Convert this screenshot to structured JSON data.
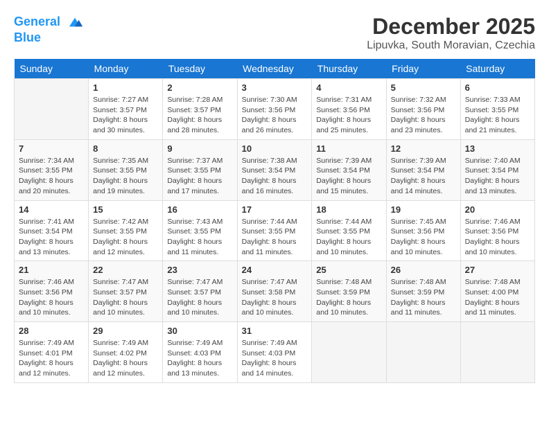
{
  "header": {
    "logo_line1": "General",
    "logo_line2": "Blue",
    "month_title": "December 2025",
    "location": "Lipuvka, South Moravian, Czechia"
  },
  "days_of_week": [
    "Sunday",
    "Monday",
    "Tuesday",
    "Wednesday",
    "Thursday",
    "Friday",
    "Saturday"
  ],
  "weeks": [
    [
      {
        "day": "",
        "sunrise": "",
        "sunset": "",
        "daylight": ""
      },
      {
        "day": "1",
        "sunrise": "Sunrise: 7:27 AM",
        "sunset": "Sunset: 3:57 PM",
        "daylight": "Daylight: 8 hours and 30 minutes."
      },
      {
        "day": "2",
        "sunrise": "Sunrise: 7:28 AM",
        "sunset": "Sunset: 3:57 PM",
        "daylight": "Daylight: 8 hours and 28 minutes."
      },
      {
        "day": "3",
        "sunrise": "Sunrise: 7:30 AM",
        "sunset": "Sunset: 3:56 PM",
        "daylight": "Daylight: 8 hours and 26 minutes."
      },
      {
        "day": "4",
        "sunrise": "Sunrise: 7:31 AM",
        "sunset": "Sunset: 3:56 PM",
        "daylight": "Daylight: 8 hours and 25 minutes."
      },
      {
        "day": "5",
        "sunrise": "Sunrise: 7:32 AM",
        "sunset": "Sunset: 3:56 PM",
        "daylight": "Daylight: 8 hours and 23 minutes."
      },
      {
        "day": "6",
        "sunrise": "Sunrise: 7:33 AM",
        "sunset": "Sunset: 3:55 PM",
        "daylight": "Daylight: 8 hours and 21 minutes."
      }
    ],
    [
      {
        "day": "7",
        "sunrise": "Sunrise: 7:34 AM",
        "sunset": "Sunset: 3:55 PM",
        "daylight": "Daylight: 8 hours and 20 minutes."
      },
      {
        "day": "8",
        "sunrise": "Sunrise: 7:35 AM",
        "sunset": "Sunset: 3:55 PM",
        "daylight": "Daylight: 8 hours and 19 minutes."
      },
      {
        "day": "9",
        "sunrise": "Sunrise: 7:37 AM",
        "sunset": "Sunset: 3:55 PM",
        "daylight": "Daylight: 8 hours and 17 minutes."
      },
      {
        "day": "10",
        "sunrise": "Sunrise: 7:38 AM",
        "sunset": "Sunset: 3:54 PM",
        "daylight": "Daylight: 8 hours and 16 minutes."
      },
      {
        "day": "11",
        "sunrise": "Sunrise: 7:39 AM",
        "sunset": "Sunset: 3:54 PM",
        "daylight": "Daylight: 8 hours and 15 minutes."
      },
      {
        "day": "12",
        "sunrise": "Sunrise: 7:39 AM",
        "sunset": "Sunset: 3:54 PM",
        "daylight": "Daylight: 8 hours and 14 minutes."
      },
      {
        "day": "13",
        "sunrise": "Sunrise: 7:40 AM",
        "sunset": "Sunset: 3:54 PM",
        "daylight": "Daylight: 8 hours and 13 minutes."
      }
    ],
    [
      {
        "day": "14",
        "sunrise": "Sunrise: 7:41 AM",
        "sunset": "Sunset: 3:54 PM",
        "daylight": "Daylight: 8 hours and 13 minutes."
      },
      {
        "day": "15",
        "sunrise": "Sunrise: 7:42 AM",
        "sunset": "Sunset: 3:55 PM",
        "daylight": "Daylight: 8 hours and 12 minutes."
      },
      {
        "day": "16",
        "sunrise": "Sunrise: 7:43 AM",
        "sunset": "Sunset: 3:55 PM",
        "daylight": "Daylight: 8 hours and 11 minutes."
      },
      {
        "day": "17",
        "sunrise": "Sunrise: 7:44 AM",
        "sunset": "Sunset: 3:55 PM",
        "daylight": "Daylight: 8 hours and 11 minutes."
      },
      {
        "day": "18",
        "sunrise": "Sunrise: 7:44 AM",
        "sunset": "Sunset: 3:55 PM",
        "daylight": "Daylight: 8 hours and 10 minutes."
      },
      {
        "day": "19",
        "sunrise": "Sunrise: 7:45 AM",
        "sunset": "Sunset: 3:56 PM",
        "daylight": "Daylight: 8 hours and 10 minutes."
      },
      {
        "day": "20",
        "sunrise": "Sunrise: 7:46 AM",
        "sunset": "Sunset: 3:56 PM",
        "daylight": "Daylight: 8 hours and 10 minutes."
      }
    ],
    [
      {
        "day": "21",
        "sunrise": "Sunrise: 7:46 AM",
        "sunset": "Sunset: 3:56 PM",
        "daylight": "Daylight: 8 hours and 10 minutes."
      },
      {
        "day": "22",
        "sunrise": "Sunrise: 7:47 AM",
        "sunset": "Sunset: 3:57 PM",
        "daylight": "Daylight: 8 hours and 10 minutes."
      },
      {
        "day": "23",
        "sunrise": "Sunrise: 7:47 AM",
        "sunset": "Sunset: 3:57 PM",
        "daylight": "Daylight: 8 hours and 10 minutes."
      },
      {
        "day": "24",
        "sunrise": "Sunrise: 7:47 AM",
        "sunset": "Sunset: 3:58 PM",
        "daylight": "Daylight: 8 hours and 10 minutes."
      },
      {
        "day": "25",
        "sunrise": "Sunrise: 7:48 AM",
        "sunset": "Sunset: 3:59 PM",
        "daylight": "Daylight: 8 hours and 10 minutes."
      },
      {
        "day": "26",
        "sunrise": "Sunrise: 7:48 AM",
        "sunset": "Sunset: 3:59 PM",
        "daylight": "Daylight: 8 hours and 11 minutes."
      },
      {
        "day": "27",
        "sunrise": "Sunrise: 7:48 AM",
        "sunset": "Sunset: 4:00 PM",
        "daylight": "Daylight: 8 hours and 11 minutes."
      }
    ],
    [
      {
        "day": "28",
        "sunrise": "Sunrise: 7:49 AM",
        "sunset": "Sunset: 4:01 PM",
        "daylight": "Daylight: 8 hours and 12 minutes."
      },
      {
        "day": "29",
        "sunrise": "Sunrise: 7:49 AM",
        "sunset": "Sunset: 4:02 PM",
        "daylight": "Daylight: 8 hours and 12 minutes."
      },
      {
        "day": "30",
        "sunrise": "Sunrise: 7:49 AM",
        "sunset": "Sunset: 4:03 PM",
        "daylight": "Daylight: 8 hours and 13 minutes."
      },
      {
        "day": "31",
        "sunrise": "Sunrise: 7:49 AM",
        "sunset": "Sunset: 4:03 PM",
        "daylight": "Daylight: 8 hours and 14 minutes."
      },
      {
        "day": "",
        "sunrise": "",
        "sunset": "",
        "daylight": ""
      },
      {
        "day": "",
        "sunrise": "",
        "sunset": "",
        "daylight": ""
      },
      {
        "day": "",
        "sunrise": "",
        "sunset": "",
        "daylight": ""
      }
    ]
  ]
}
